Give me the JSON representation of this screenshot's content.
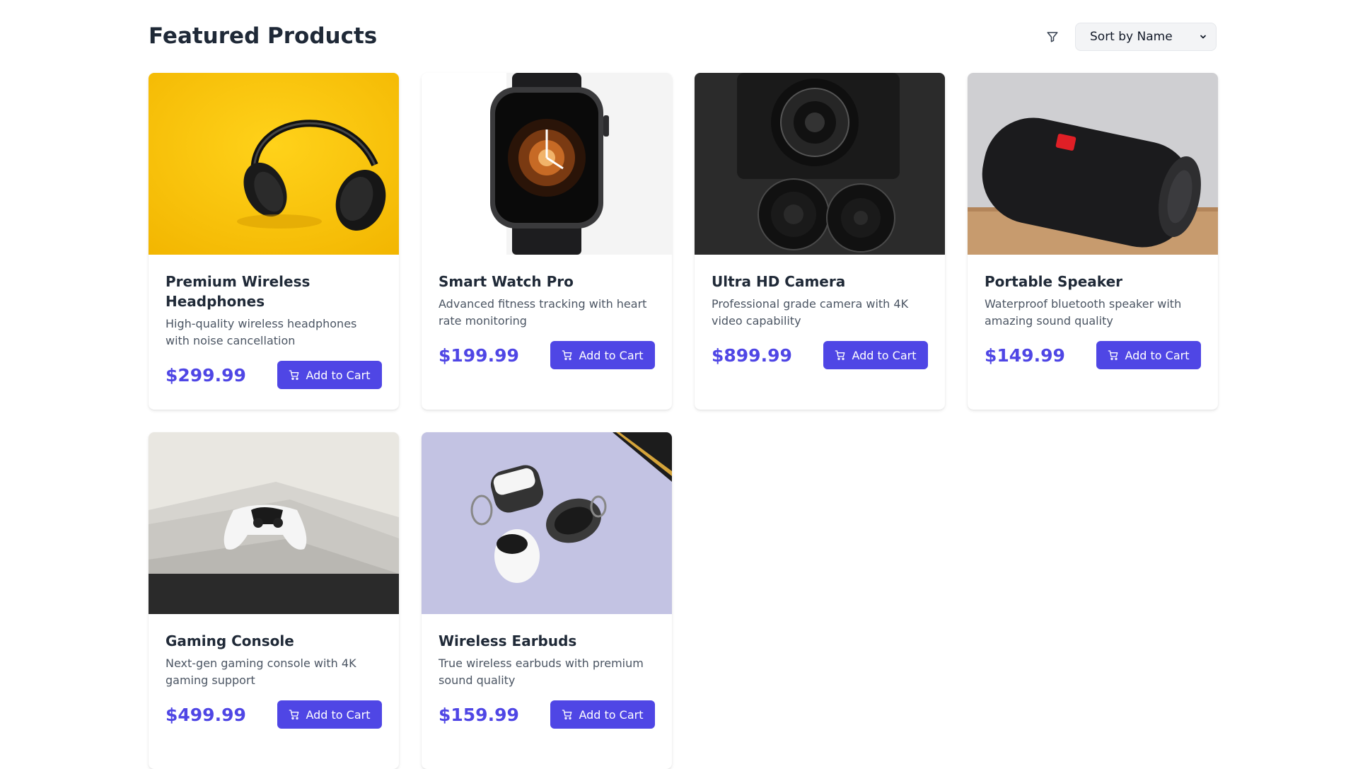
{
  "header": {
    "title": "Featured Products",
    "sort": {
      "selected": "Sort by Name"
    },
    "filter_icon": "filter-icon"
  },
  "colors": {
    "accent": "#4f46e5",
    "title": "#1f2937",
    "desc": "#4b5563"
  },
  "products": [
    {
      "name": "Premium Wireless Headphones",
      "description": "High-quality wireless headphones with noise cancellation",
      "price": "$299.99",
      "cart_label": "Add to Cart",
      "image_icon": "headphones-image"
    },
    {
      "name": "Smart Watch Pro",
      "description": "Advanced fitness tracking with heart rate monitoring",
      "price": "$199.99",
      "cart_label": "Add to Cart",
      "image_icon": "smartwatch-image"
    },
    {
      "name": "Ultra HD Camera",
      "description": "Professional grade camera with 4K video capability",
      "price": "$899.99",
      "cart_label": "Add to Cart",
      "image_icon": "camera-image"
    },
    {
      "name": "Portable Speaker",
      "description": "Waterproof bluetooth speaker with amazing sound quality",
      "price": "$149.99",
      "cart_label": "Add to Cart",
      "image_icon": "speaker-image"
    },
    {
      "name": "Gaming Console",
      "description": "Next-gen gaming console with 4K gaming support",
      "price": "$499.99",
      "cart_label": "Add to Cart",
      "image_icon": "console-image"
    },
    {
      "name": "Wireless Earbuds",
      "description": "True wireless earbuds with premium sound quality",
      "price": "$159.99",
      "cart_label": "Add to Cart",
      "image_icon": "earbuds-image"
    }
  ]
}
